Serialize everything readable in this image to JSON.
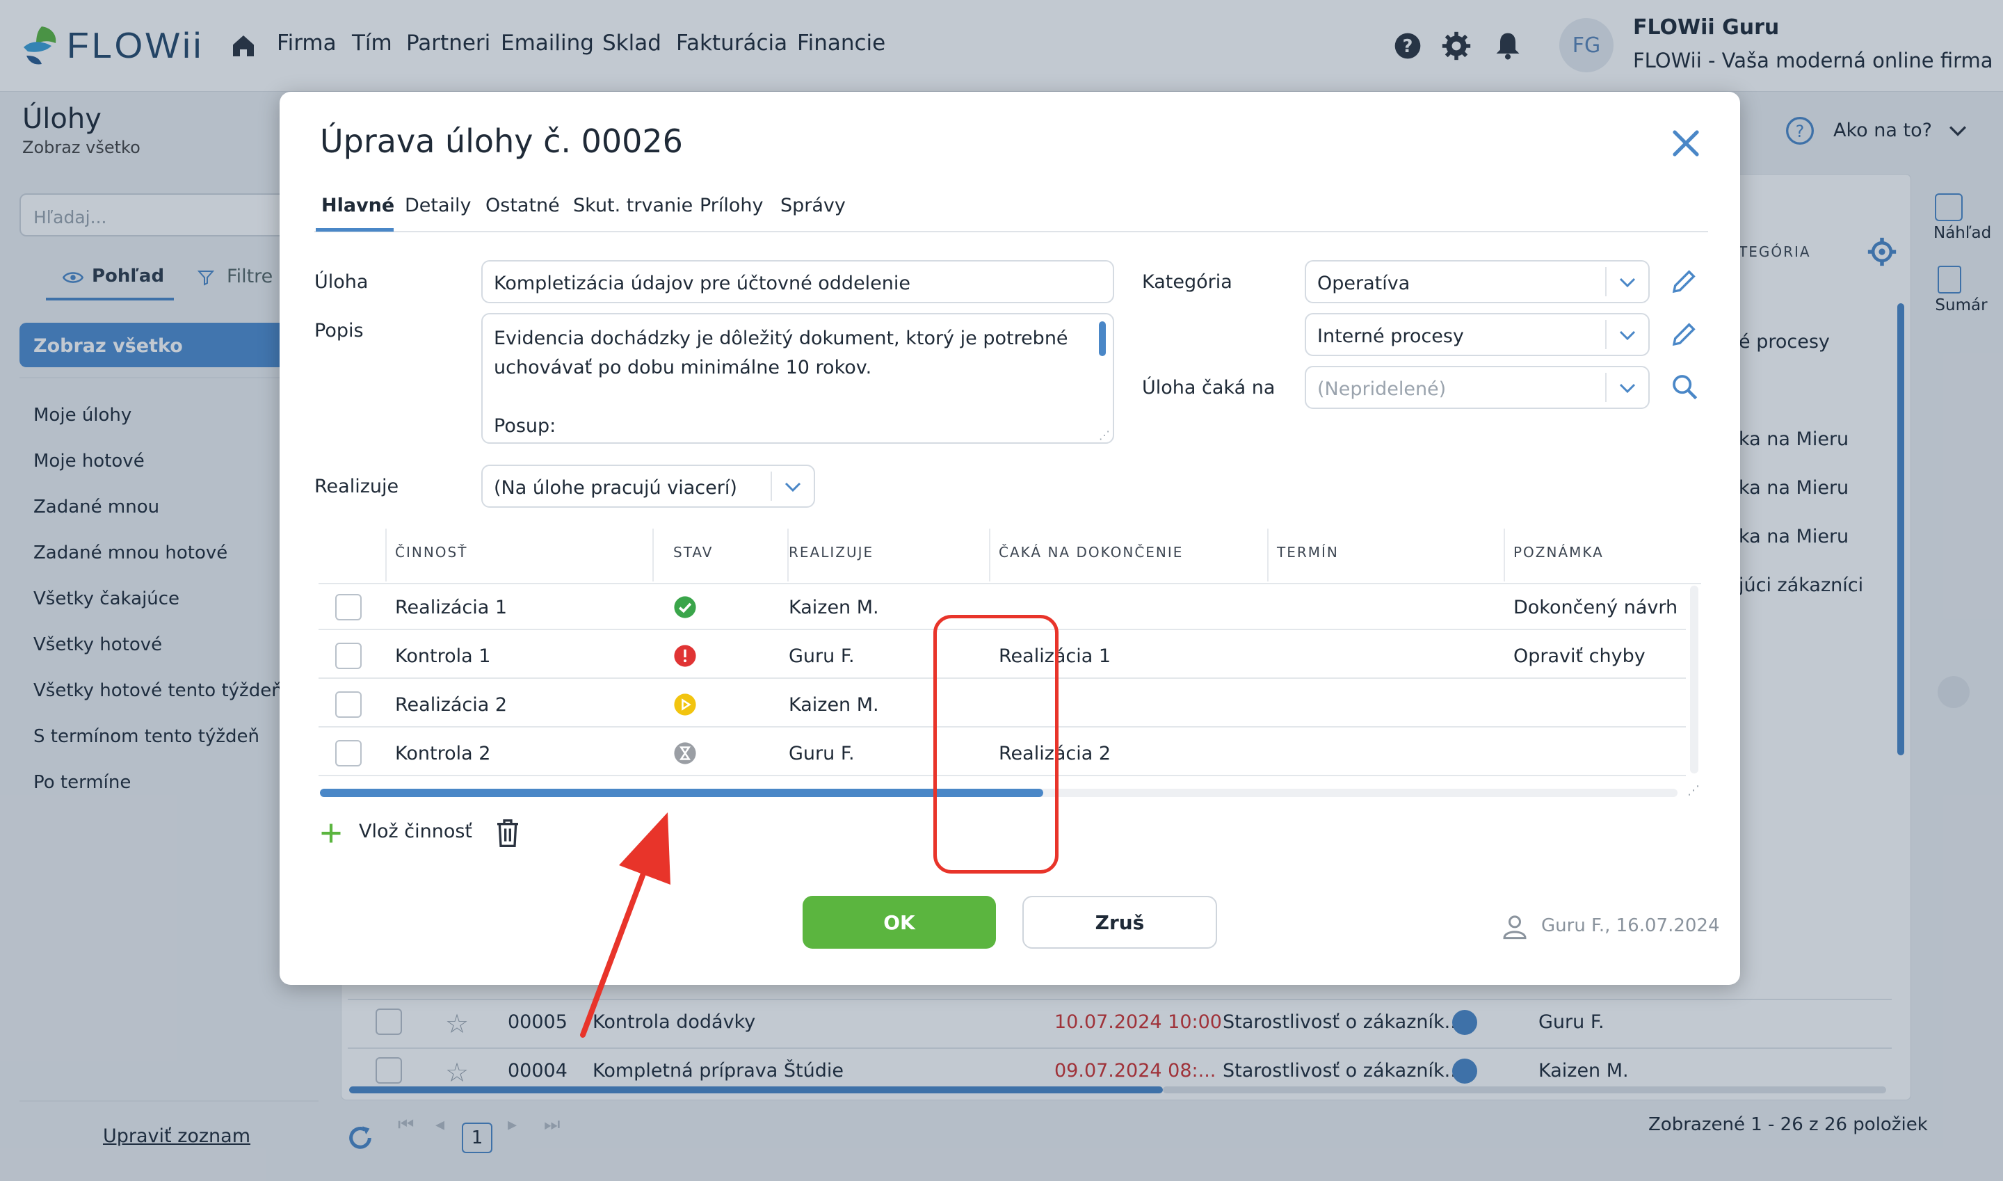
{
  "app": {
    "logo_text": "FLOWii",
    "nav": [
      "Firma",
      "Tím",
      "Partneri",
      "Emailing",
      "Sklad",
      "Fakturácia",
      "Financie"
    ],
    "user_initials": "FG",
    "user_name": "FLOWii Guru",
    "user_subtitle": "FLOWii - Vaša moderná online firma"
  },
  "page": {
    "title": "Úlohy",
    "subtitle": "Zobraz všetko",
    "help_label": "Ako na to?",
    "search_placeholder": "Hľadaj...",
    "view_tab": "Pohľad",
    "filter_tab": "Filtre",
    "active_view": "Zobraz všetko",
    "views": [
      "Moje úlohy",
      "Moje hotové",
      "Zadané mnou",
      "Zadané mnou hotové",
      "Všetky čakajúce",
      "Všetky hotové",
      "Všetky hotové tento týždeň",
      "S termínom tento týždeň",
      "Po termíne"
    ],
    "edit_list": "Upraviť zoznam",
    "right_preview": "Náhľad",
    "right_summary": "Sumár",
    "col_category_partial": "TEGÓRIA",
    "bg_partial_texts": [
      "é procesy",
      "ka na Mieru",
      "ka na Mieru",
      "ka na Mieru",
      "júci zákazníci"
    ],
    "bg_rows": [
      {
        "id": "00005",
        "name": "Kontrola dodávky",
        "date": "10.07.2024 10:00",
        "category": "Starostlivosť o zákazník...",
        "user": "Guru F."
      },
      {
        "id": "00004",
        "name": "Kompletná príprava Štúdie",
        "date": "09.07.2024 08:...",
        "category": "Starostlivosť o zákazník...",
        "user": "Kaizen M."
      }
    ],
    "pager_current": "1",
    "pager_summary": "Zobrazené 1 - 26 z 26 položiek"
  },
  "modal": {
    "title": "Úprava úlohy č. 00026",
    "tabs": [
      "Hlavné",
      "Detaily",
      "Ostatné",
      "Skut. trvanie",
      "Prílohy",
      "Správy"
    ],
    "labels": {
      "task": "Úloha",
      "description": "Popis",
      "category": "Kategória",
      "waits_for": "Úloha čaká na",
      "realizes": "Realizuje"
    },
    "task_value": "Kompletizácia údajov pre účtovné oddelenie",
    "description_lines": [
      "Evidencia dochádzky je dôležitý dokument, ktorý je potrebné",
      "uchovávať po dobu minimálne 10 rokov.",
      "",
      "Posup:"
    ],
    "category_value": "Operatíva",
    "subcategory_value": "Interné procesy",
    "waits_for_placeholder": "(Nepridelené)",
    "realizes_value": "(Na úlohe pracujú viacerí)",
    "table_headers": [
      "ČINNOSŤ",
      "STAV",
      "REALIZUJE",
      "ČAKÁ NA DOKONČENIE",
      "TERMÍN",
      "POZNÁMKA"
    ],
    "activities": [
      {
        "name": "Realizácia 1",
        "status": "done",
        "status_icon": "check-circle-icon",
        "status_color": "#3aa54a",
        "realizes": "Kaizen M.",
        "waits": "",
        "deadline": "",
        "note": "Dokončený návrh"
      },
      {
        "name": "Kontrola 1",
        "status": "problem",
        "status_icon": "exclamation-circle-icon",
        "status_color": "#e03434",
        "realizes": "Guru F.",
        "waits": "Realizácia 1",
        "deadline": "",
        "note": "Opraviť chyby"
      },
      {
        "name": "Realizácia 2",
        "status": "in-progress",
        "status_icon": "play-circle-icon",
        "status_color": "#f2c40f",
        "realizes": "Kaizen M.",
        "waits": "",
        "deadline": "",
        "note": ""
      },
      {
        "name": "Kontrola 2",
        "status": "waiting",
        "status_icon": "hourglass-circle-icon",
        "status_color": "#9a9ea4",
        "realizes": "Guru F.",
        "waits": "Realizácia 2",
        "deadline": "",
        "note": ""
      }
    ],
    "add_activity": "Vlož činnosť",
    "ok_label": "OK",
    "cancel_label": "Zruš",
    "author_info": "Guru F., 16.07.2024"
  },
  "colors": {
    "accent": "#4a87c7",
    "ok_green": "#5bb53f",
    "highlight_red": "#e8342a",
    "overdue_red": "#d0302f"
  }
}
